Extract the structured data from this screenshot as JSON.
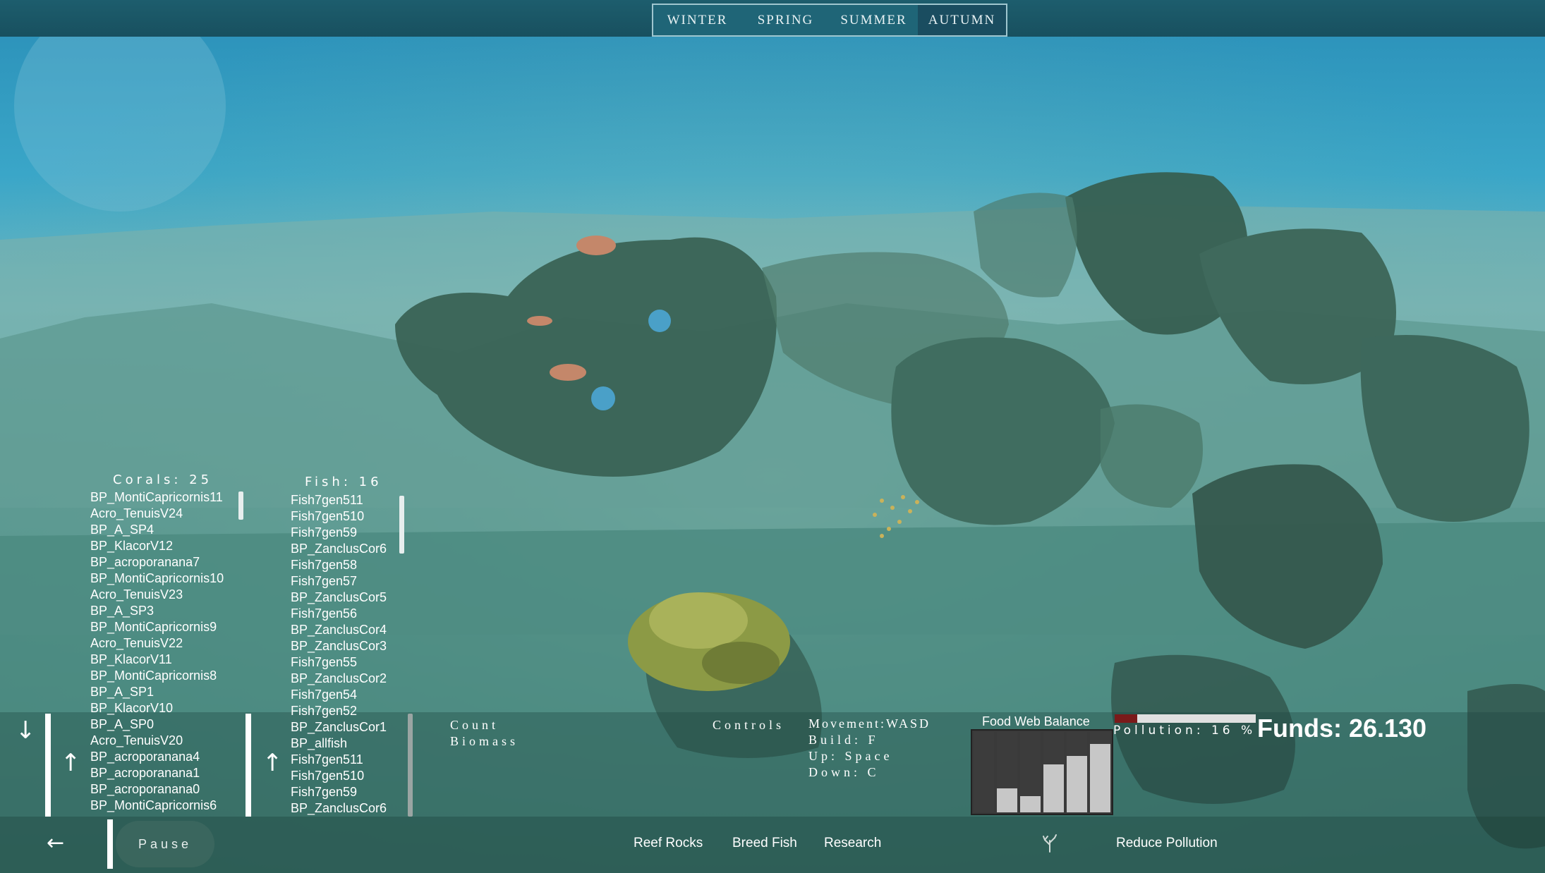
{
  "seasons": {
    "items": [
      "WINTER",
      "SPRING",
      "SUMMER",
      "AUTUMN"
    ],
    "active": "AUTUMN"
  },
  "corals": {
    "title": "Corals: 25",
    "items": [
      "BP_MontiCapricornis11",
      "Acro_TenuisV24",
      "BP_A_SP4",
      "BP_KlacorV12",
      "BP_acroporanana7",
      "BP_MontiCapricornis10",
      "Acro_TenuisV23",
      "BP_A_SP3",
      "BP_MontiCapricornis9",
      "Acro_TenuisV22",
      "BP_KlacorV11",
      "BP_MontiCapricornis8",
      "BP_A_SP1",
      "BP_KlacorV10",
      "BP_A_SP0",
      "Acro_TenuisV20",
      "BP_acroporanana4",
      "BP_acroporanana1",
      "BP_acroporanana0",
      "BP_MontiCapricornis6"
    ]
  },
  "fish": {
    "title": "Fish: 16",
    "items": [
      "Fish7gen511",
      "Fish7gen510",
      "Fish7gen59",
      "BP_ZanclusCor6",
      "Fish7gen58",
      "Fish7gen57",
      "BP_ZanclusCor5",
      "Fish7gen56",
      "BP_ZanclusCor4",
      "BP_ZanclusCor3",
      "Fish7gen55",
      "BP_ZanclusCor2",
      "Fish7gen54",
      "Fish7gen52",
      "BP_ZanclusCor1",
      "BP_allfish",
      "Fish7gen511",
      "Fish7gen510",
      "Fish7gen59",
      "BP_ZanclusCor6"
    ]
  },
  "sort": {
    "count": "Count",
    "biomass": "Biomass"
  },
  "controls": {
    "title": "Controls",
    "movement": "Movement:WASD",
    "build": "Build: F",
    "up": "Up: Space",
    "down": "Down: C"
  },
  "food_web": {
    "title": "Food Web Balance",
    "levels": [
      0,
      0.3,
      0.2,
      0.6,
      0.7,
      0.85
    ]
  },
  "pollution": {
    "label": "Pollution: 16 %",
    "value": 0.16
  },
  "funds": {
    "label": "Funds: 26.130"
  },
  "bottom": {
    "back": "←",
    "pause": "Pause",
    "reef_rocks": "Reef Rocks",
    "breed_fish": "Breed Fish",
    "research": "Research",
    "reduce_pollution": "Reduce Pollution"
  },
  "arrows": {
    "down": "↓",
    "up": "↑"
  },
  "colors": {
    "topbar": "#1d5d6d",
    "water": "#3f7f78",
    "pollution_fill": "#7a1a1a"
  }
}
